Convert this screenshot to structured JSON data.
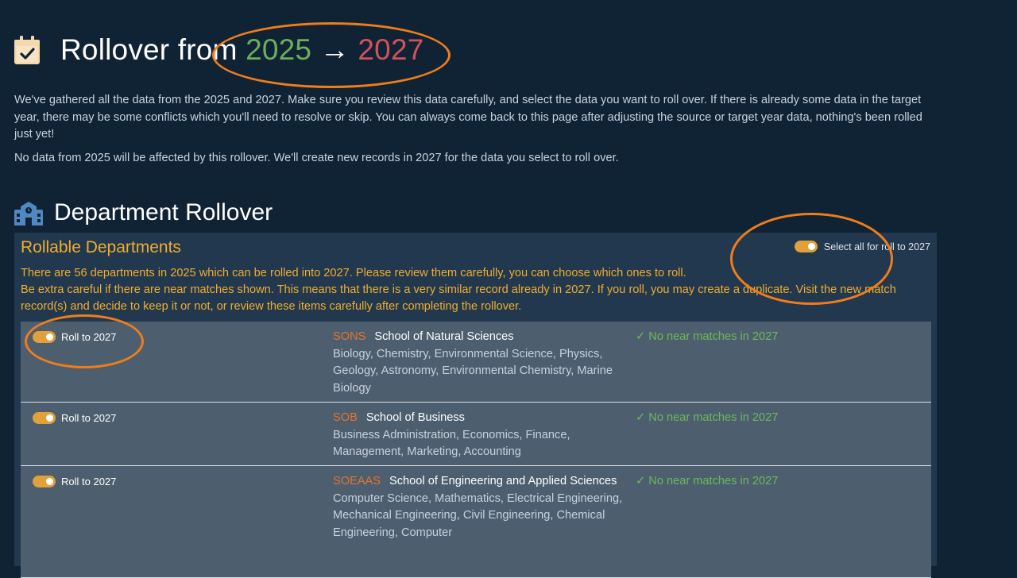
{
  "page": {
    "title_prefix": "Rollover from",
    "from_year": "2025",
    "arrow": "→",
    "to_year": "2027",
    "icon": "calendar-check-icon"
  },
  "intro": {
    "paragraph1": "We've gathered all the data from the 2025 and 2027. Make sure you review this data carefully, and select the data you want to roll over. If there is already some data in the target year, there may be some conflicts which you'll need to resolve or skip. You can always come back to this page after adjusting the source or target year data, nothing's been rolled just yet!",
    "paragraph2": "No data from 2025 will be affected by this rollover. We'll create new records in 2027 for the data you select to roll over."
  },
  "section": {
    "title": "Department Rollover",
    "icon": "school-icon"
  },
  "panel": {
    "title": "Rollable Departments",
    "select_all_label": "Select all for roll to 2027",
    "select_all_on": true,
    "desc_line1": "There are 56 departments in 2025 which can be rolled into 2027. Please review them carefully, you can choose which ones to roll.",
    "desc_line2": "Be extra careful if there are near matches shown. This means that there is a very similar record already in 2027. If you roll, you may create a duplicate. Visit the new match record(s) and decide to keep it or not, or review these items carefully after completing the rollover."
  },
  "departments": [
    {
      "roll_label": "Roll to 2027",
      "roll_on": true,
      "code": "SONS",
      "name": "School of Natural Sciences",
      "subjects": "Biology, Chemistry, Environmental Science, Physics, Geology, Astronomy, Environmental Chemistry, Marine Biology",
      "match_status": "✓ No near matches in 2027"
    },
    {
      "roll_label": "Roll to 2027",
      "roll_on": true,
      "code": "SOB",
      "name": "School of Business",
      "subjects": "Business Administration, Economics, Finance, Management, Marketing, Accounting",
      "match_status": "✓ No near matches in 2027"
    },
    {
      "roll_label": "Roll to 2027",
      "roll_on": true,
      "code": "SOEAAS",
      "name": "School of Engineering and Applied Sciences",
      "subjects": "Computer Science, Mathematics, Electrical Engineering, Mechanical Engineering, Civil Engineering, Chemical Engineering, Computer",
      "match_status": "✓ No near matches in 2027"
    }
  ],
  "colors": {
    "background": "#102335",
    "panel": "#22384f",
    "row": "#4d5f6e",
    "accent_orange": "#f0ad2e",
    "from_year_green": "#6cae5a",
    "to_year_red": "#d1525a",
    "code_orange": "#e47331",
    "match_green": "#6cb85c",
    "annotation_orange": "#f07d1a"
  }
}
